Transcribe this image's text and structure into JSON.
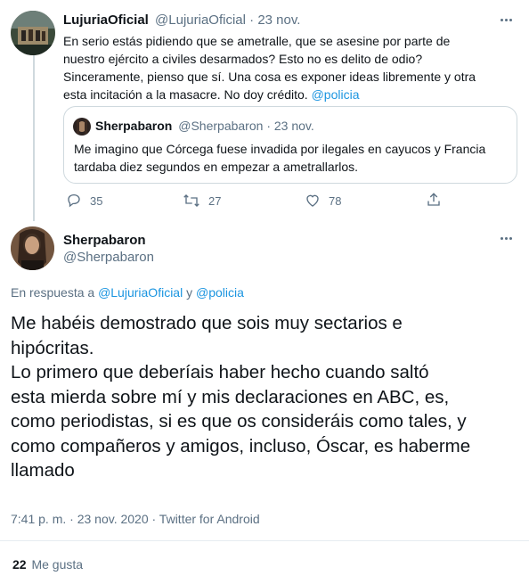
{
  "colors": {
    "link": "#1b95e0",
    "muted": "#5b7083",
    "text": "#0f1419",
    "border": "#cfd9de"
  },
  "parent_tweet": {
    "display_name": "LujuriaOficial",
    "handle": "@LujuriaOficial",
    "separator": "·",
    "date": "23 nov.",
    "text_lines": [
      "En serio estás pidiendo que se ametralle, que se asesine por parte de",
      "nuestro ejército a civiles desarmados? Esto no es delito de odio?",
      "Sinceramente, pienso que sí. Una cosa es exponer ideas libremente y otra",
      "esta incitación a la masacre. No doy crédito."
    ],
    "mention": "@policia",
    "quoted": {
      "display_name": "Sherpabaron",
      "handle": "@Sherpabaron",
      "date": "23 nov.",
      "text_lines": [
        "Me imagino que Córcega fuese invadida por ilegales en cayucos y Francia",
        "tardaba diez segundos en empezar a ametrallarlos."
      ]
    },
    "actions": {
      "replies": "35",
      "retweets": "27",
      "likes": "78"
    },
    "icons": [
      "reply-icon",
      "retweet-icon",
      "like-icon",
      "share-icon",
      "more-icon"
    ]
  },
  "main_tweet": {
    "display_name": "Sherpabaron",
    "handle": "@Sherpabaron",
    "reply_prefix": "En respuesta a",
    "reply_user1": "@LujuriaOficial",
    "reply_and": "y",
    "reply_user2": "@policia",
    "text_lines": [
      "Me habéis demostrado que sois muy sectarios e",
      "hipócritas.",
      "Lo primero que deberíais haber hecho cuando saltó",
      "esta mierda sobre mí y mis declaraciones en ABC, es,",
      "como periodistas, si es que os consideráis como tales, y",
      "como compañeros y amigos, incluso, Óscar, es haberme",
      "llamado"
    ],
    "timestamp": "7:41 p. m. · 23 nov. 2020 · Twitter for Android",
    "likes_count": "22",
    "likes_label": "Me gusta"
  }
}
